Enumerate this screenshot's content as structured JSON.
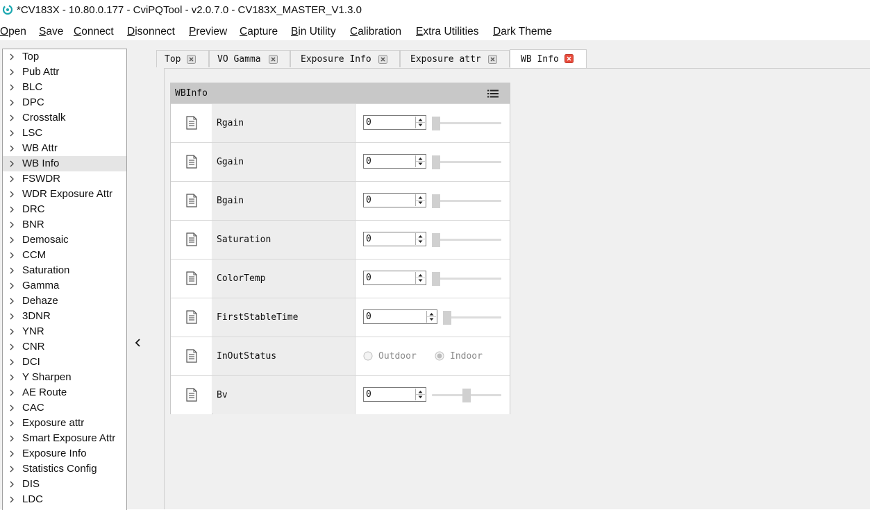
{
  "window": {
    "title": "*CV183X - 10.80.0.177 - CviPQTool - v2.0.7.0 - CV183X_MASTER_V1.3.0",
    "app_icon": "cvi-logo-icon"
  },
  "menu": [
    "Open",
    "Save",
    "Connect",
    "Disonnect",
    "Preview",
    "Capture",
    "Bin Utility",
    "Calibration",
    "Extra Utilities",
    "Dark Theme"
  ],
  "sidebar": {
    "selected": "WB Info",
    "items": [
      "Top",
      "Pub Attr",
      "BLC",
      "DPC",
      "Crosstalk",
      "LSC",
      "WB Attr",
      "WB Info",
      "FSWDR",
      "WDR Exposure Attr",
      "DRC",
      "BNR",
      "Demosaic",
      "CCM",
      "Saturation",
      "Gamma",
      "Dehaze",
      "3DNR",
      "YNR",
      "CNR",
      "DCI",
      "Y Sharpen",
      "AE Route",
      "CAC",
      "Exposure attr",
      "Smart Exposure Attr",
      "Exposure Info",
      "Statistics Config",
      "DIS",
      "LDC"
    ]
  },
  "tabs": [
    {
      "label": "Top",
      "active": false
    },
    {
      "label": "VO Gamma",
      "active": false
    },
    {
      "label": "Exposure Info",
      "active": false
    },
    {
      "label": "Exposure attr",
      "active": false
    },
    {
      "label": "WB Info",
      "active": true
    }
  ],
  "panel": {
    "title": "WBInfo",
    "rows": [
      {
        "label": "Rgain",
        "type": "spin",
        "value": "0",
        "slider_fraction": 0.0
      },
      {
        "label": "Ggain",
        "type": "spin",
        "value": "0",
        "slider_fraction": 0.0
      },
      {
        "label": "Bgain",
        "type": "spin",
        "value": "0",
        "slider_fraction": 0.0
      },
      {
        "label": "Saturation",
        "type": "spin",
        "value": "0",
        "slider_fraction": 0.0
      },
      {
        "label": "ColorTemp",
        "type": "spin",
        "value": "0",
        "slider_fraction": 0.0
      },
      {
        "label": "FirstStableTime",
        "type": "spin",
        "value": "0",
        "slider_fraction": 0.0
      },
      {
        "label": "InOutStatus",
        "type": "radio",
        "options": [
          "Outdoor",
          "Indoor"
        ],
        "selected": "Indoor"
      },
      {
        "label": "Bv",
        "type": "spin",
        "value": "0",
        "slider_fraction": 0.5
      }
    ]
  },
  "colors": {
    "active_tab_close": "#e84c3d",
    "panel_header": "#c8c8c8",
    "selected_sidebar": "#e5e5e5"
  }
}
